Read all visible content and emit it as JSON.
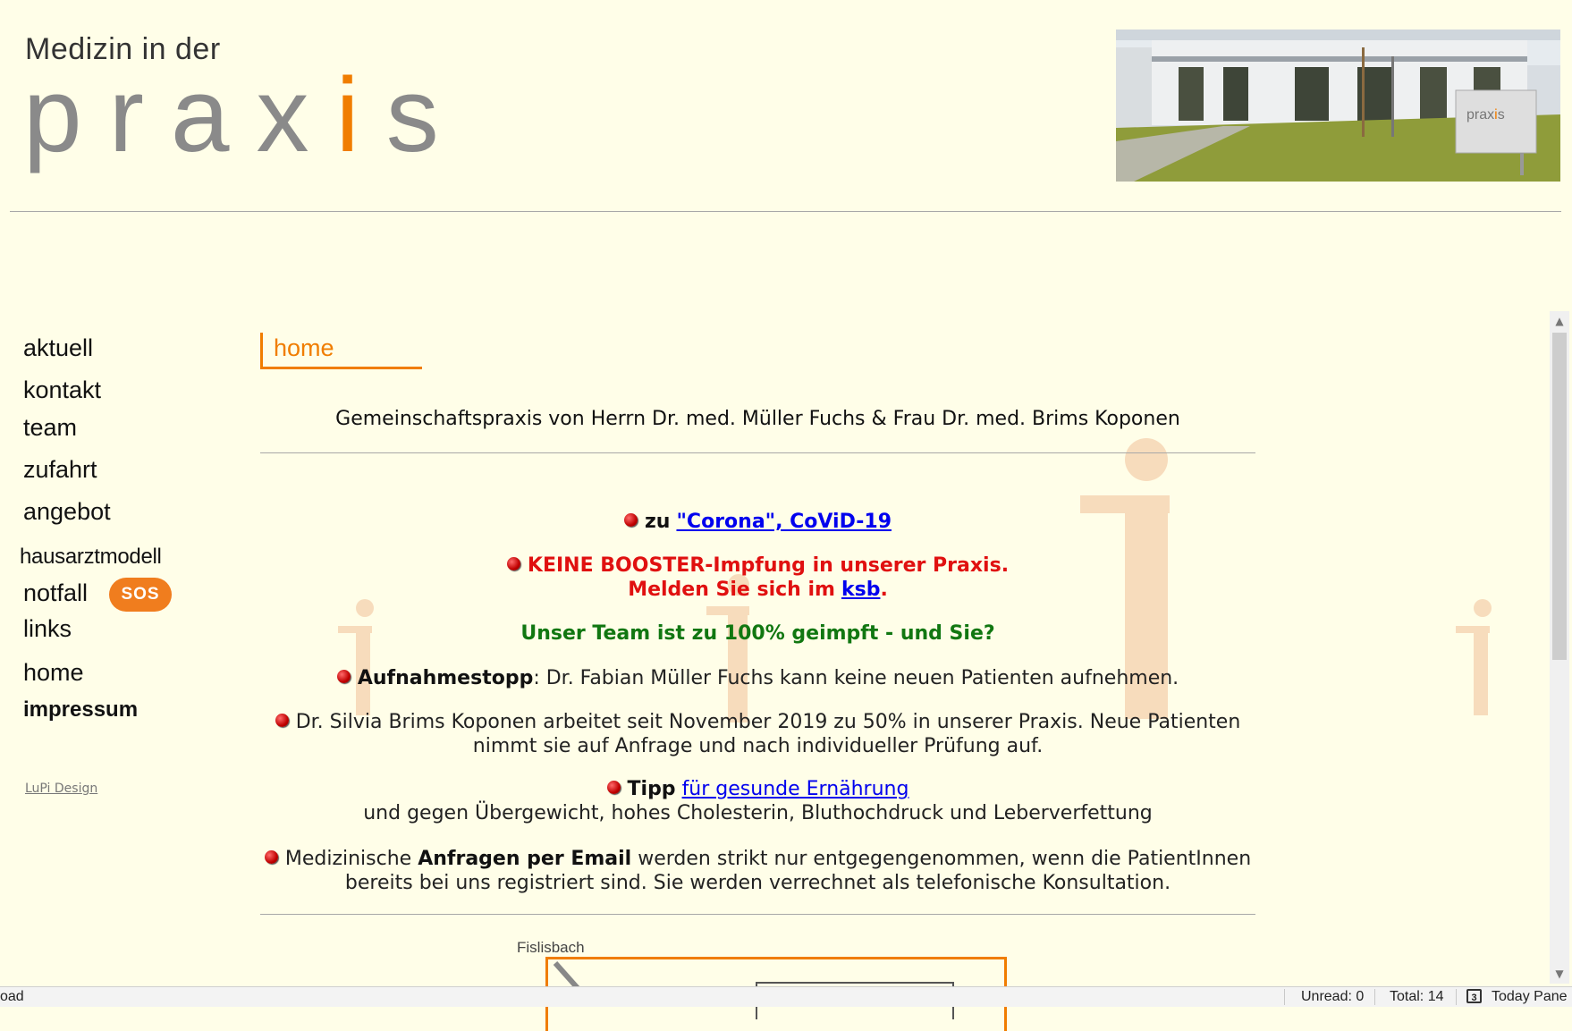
{
  "header": {
    "logo_small": "Medizin in der",
    "logo_word_a": "prax",
    "logo_word_i": "i",
    "logo_word_b": "s"
  },
  "nav": {
    "items": [
      "aktuell",
      "kontakt",
      "team",
      "zufahrt",
      "angebot",
      "hausarztmodell",
      "notfall",
      "links",
      "home",
      "impressum"
    ],
    "sos": "SOS",
    "credit": "LuPi Design"
  },
  "main": {
    "title": "home",
    "subtitle": "Gemeinschaftspraxis von Herrn Dr. med. Müller Fuchs & Frau Dr. med. Brims Koponen",
    "corona_prefix": "zu",
    "corona_link": "\"Corona\", CoViD-19",
    "booster_line1": "KEINE BOOSTER-Impfung in unserer Praxis.",
    "booster_line2_pre": "Melden Sie sich im",
    "booster_link": "ksb",
    "booster_line2_post": ".",
    "team_vaccinated": "Unser Team ist zu 100% geimpft - und Sie?",
    "stop_bold": "Aufnahmestopp",
    "stop_text": ": Dr. Fabian Müller Fuchs kann keine neuen Patienten aufnehmen.",
    "silvia_text": "Dr. Silvia Brims Koponen arbeitet seit November 2019 zu 50% in unserer Praxis. Neue Patienten nimmt sie auf Anfrage und nach individueller Prüfung auf.",
    "tipp_bold": "Tipp",
    "tipp_link": "für gesunde Ernährung",
    "tipp_text": "und gegen Übergewicht, hohes Cholesterin, Bluthochdruck und Leberverfettung",
    "email_pre": "Medizinische",
    "email_bold": "Anfragen per Email",
    "email_text": "werden strikt nur entgegengenommen, wenn die PatientInnen bereits bei uns registriert sind. Sie werden verrechnet als telefonische Konsultation.",
    "map_label": "Fislisbach"
  },
  "photo": {
    "sign_text": "prax",
    "sign_i": "i",
    "sign_s": "s"
  },
  "statusbar": {
    "left": "oad",
    "unread": "Unread: 0",
    "total": "Total: 14",
    "calendar_num": "3",
    "today_pane": "Today Pane"
  },
  "colors": {
    "background": "#fffee8",
    "accent": "#f07d00",
    "alert_red": "#e01010",
    "green": "#117711",
    "link": "#0000ee"
  }
}
